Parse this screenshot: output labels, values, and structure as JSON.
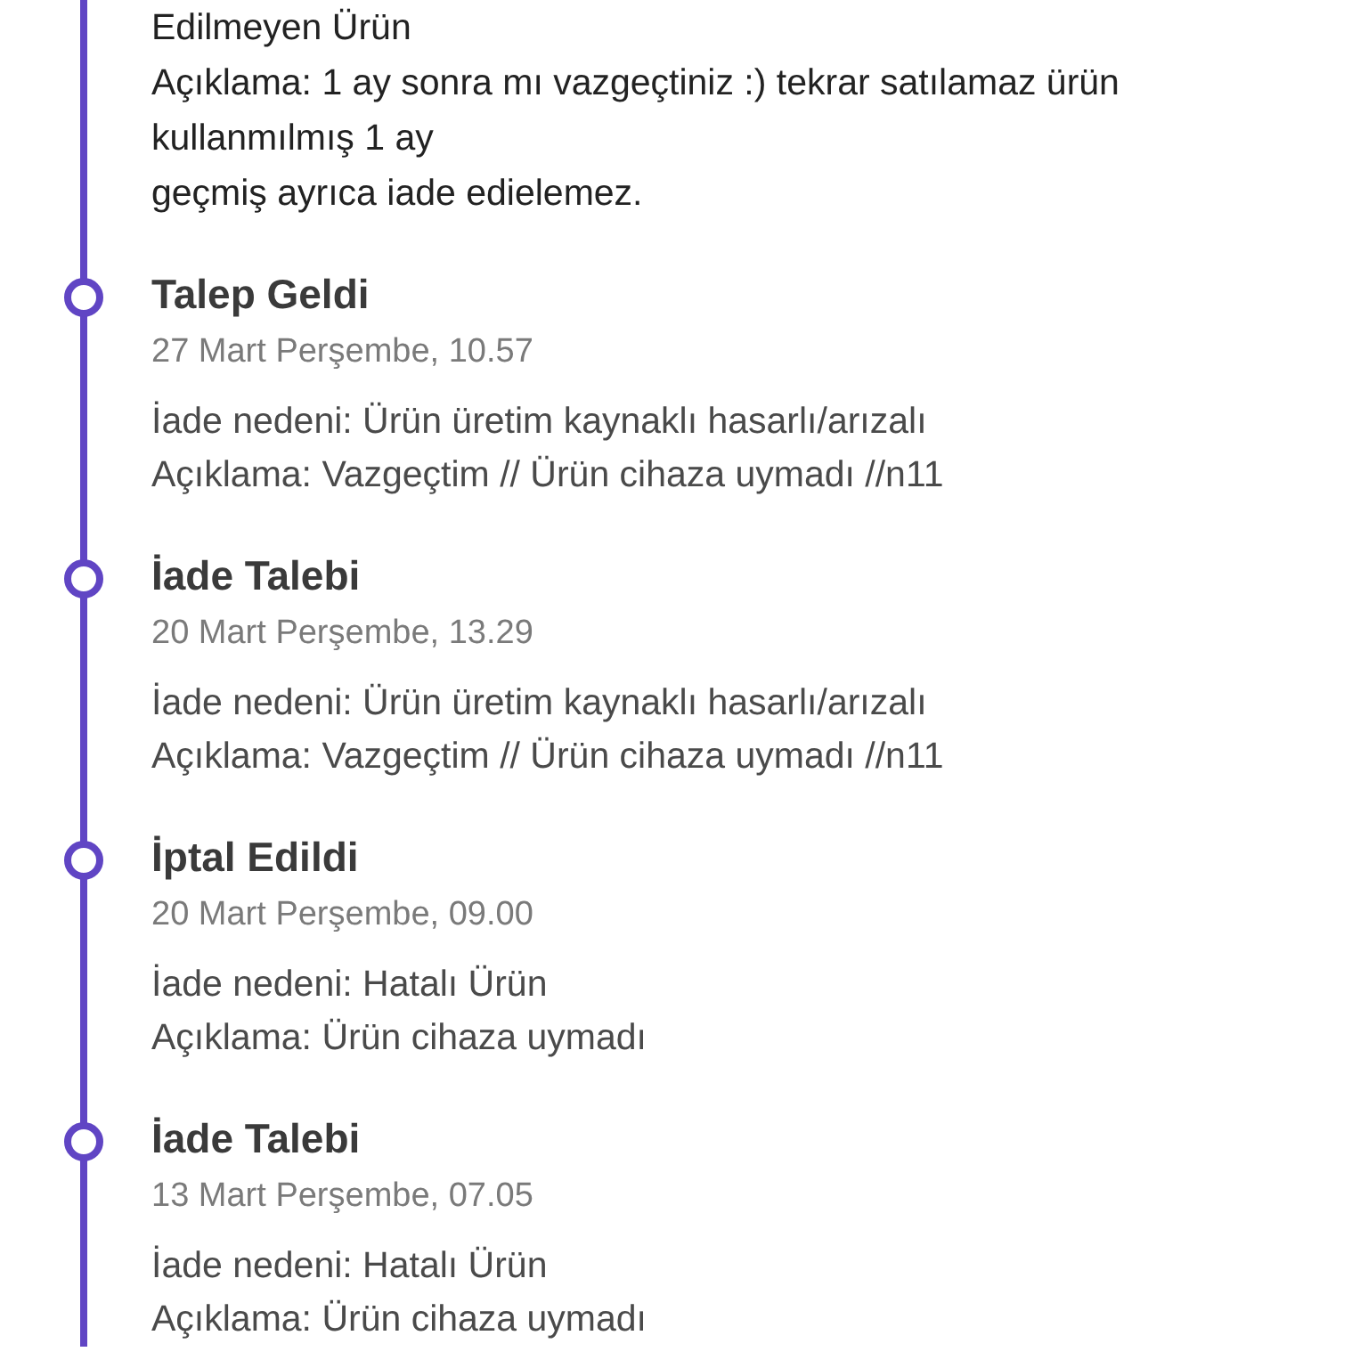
{
  "events": [
    {
      "lines": [
        "Edilmeyen Ürün",
        "Açıklama: 1 ay sonra mı vazgeçtiniz :) tekrar satılamaz ürün",
        "kullanmılmış 1 ay",
        "geçmiş ayrıca iade edielemez."
      ]
    },
    {
      "title": "Talep Geldi",
      "date": "27 Mart Perşembe, 10.57",
      "lines": [
        "İade nedeni: Ürün üretim kaynaklı hasarlı/arızalı",
        "Açıklama: Vazgeçtim // Ürün cihaza uymadı //n11"
      ]
    },
    {
      "title": "İade Talebi",
      "date": "20 Mart Perşembe, 13.29",
      "lines": [
        "İade nedeni: Ürün üretim kaynaklı hasarlı/arızalı",
        "Açıklama: Vazgeçtim // Ürün cihaza uymadı //n11"
      ]
    },
    {
      "title": "İptal Edildi",
      "date": "20 Mart Perşembe, 09.00",
      "lines": [
        "İade nedeni: Hatalı Ürün",
        "Açıklama: Ürün cihaza uymadı"
      ]
    },
    {
      "title": "İade Talebi",
      "date": "13 Mart Perşembe, 07.05",
      "lines": [
        "İade nedeni: Hatalı Ürün",
        "Açıklama: Ürün cihaza uymadı"
      ]
    }
  ]
}
